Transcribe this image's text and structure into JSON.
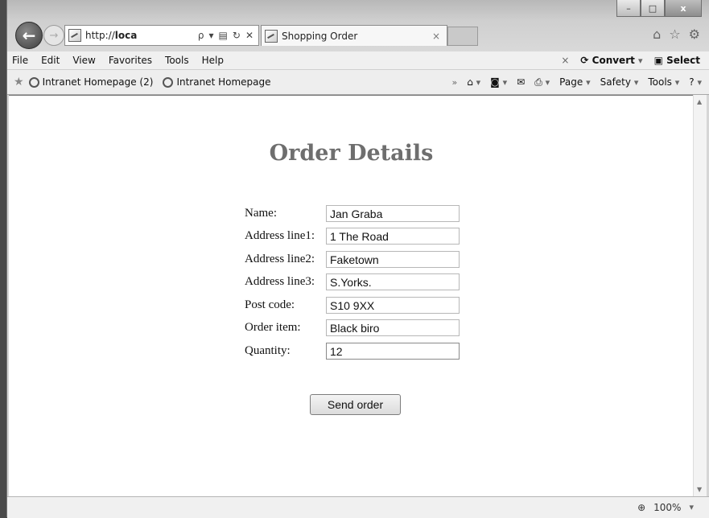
{
  "window": {
    "minimize": "–",
    "maximize": "□",
    "close": "x"
  },
  "address_bar": {
    "url_prefix": "http://",
    "url_host": "loca",
    "search": "ρ",
    "dropdown": "▾",
    "compat": "▤",
    "refresh": "↻",
    "stop": "✕"
  },
  "tab": {
    "title": "Shopping Order",
    "close": "×"
  },
  "menu": {
    "items": [
      "File",
      "Edit",
      "View",
      "Favorites",
      "Tools",
      "Help"
    ],
    "close_x": "×",
    "convert": "Convert",
    "select": "Select"
  },
  "favorites": {
    "links": [
      "Intranet Homepage (2)",
      "Intranet Homepage"
    ],
    "more": "»",
    "page": "Page",
    "safety": "Safety",
    "tools": "Tools",
    "help": "?"
  },
  "page": {
    "title": "Order Details",
    "fields": [
      {
        "label": "Name:",
        "value": "Jan Graba"
      },
      {
        "label": "Address line1:",
        "value": "1 The Road"
      },
      {
        "label": "Address line2:",
        "value": "Faketown"
      },
      {
        "label": "Address line3:",
        "value": "S.Yorks."
      },
      {
        "label": "Post code:",
        "value": "S10 9XX"
      },
      {
        "label": "Order item:",
        "value": "Black biro"
      },
      {
        "label": "Quantity:",
        "value": "12"
      }
    ],
    "submit": "Send order"
  },
  "status": {
    "zoom": "100%"
  },
  "icons": [
    "back-icon",
    "forward-icon",
    "page-icon",
    "search-icon",
    "refresh-icon",
    "stop-icon",
    "home-icon",
    "star-icon",
    "gear-icon",
    "ie-icon",
    "print-icon",
    "rss-icon",
    "mail-icon",
    "zoom-icon"
  ]
}
